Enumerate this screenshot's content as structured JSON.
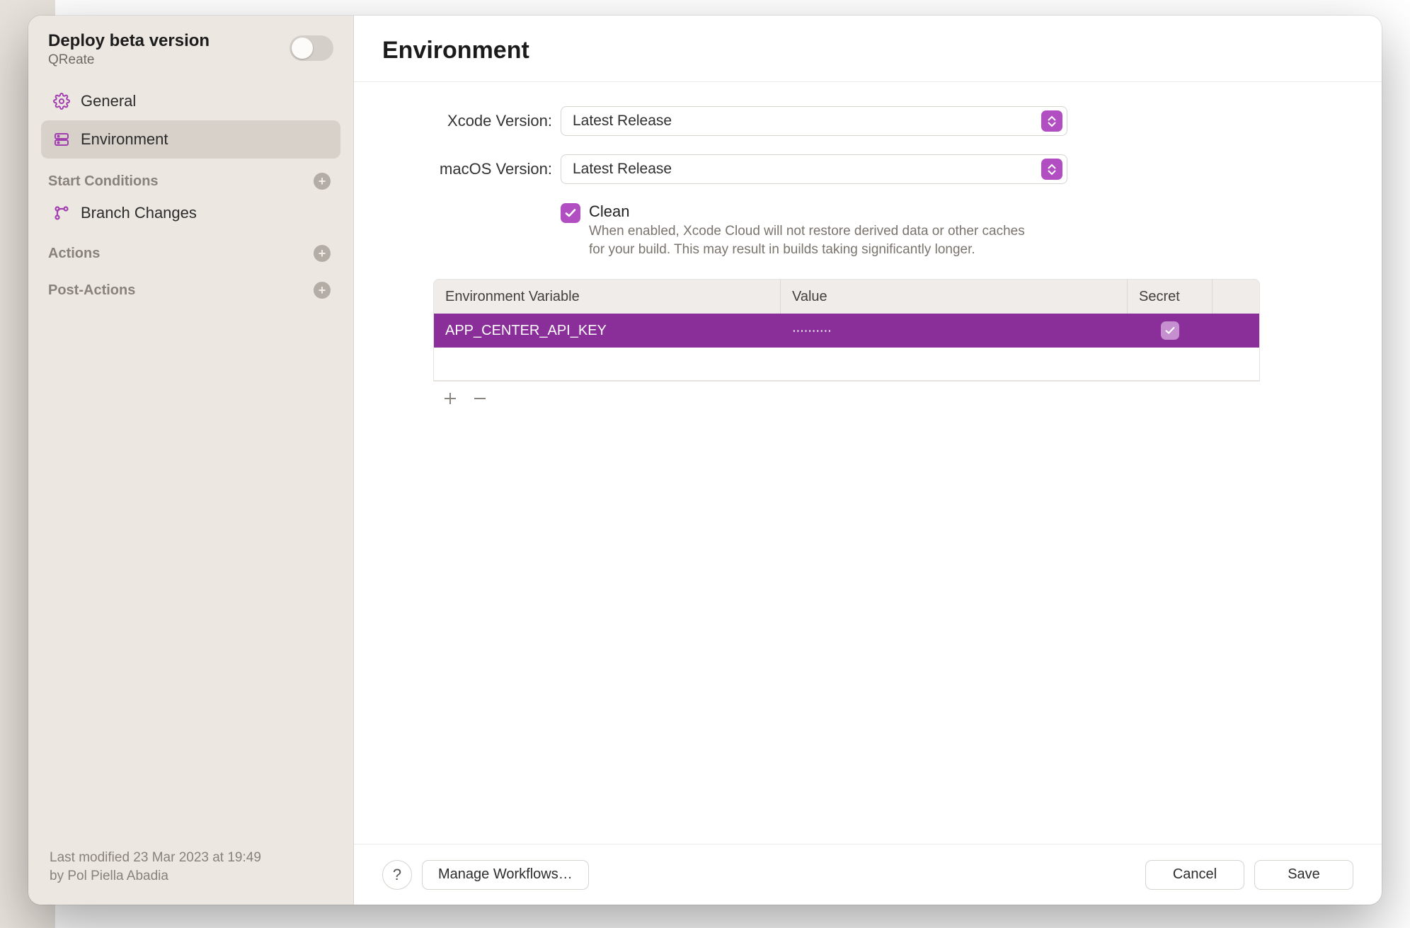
{
  "sidebar": {
    "title": "Deploy beta version",
    "subtitle": "QReate",
    "toggle_on": false,
    "nav": {
      "general": "General",
      "environment": "Environment"
    },
    "sections": {
      "start_conditions": "Start Conditions",
      "actions": "Actions",
      "post_actions": "Post-Actions"
    },
    "start_items": {
      "branch_changes": "Branch Changes"
    },
    "footer_line1": "Last modified 23 Mar 2023 at 19:49",
    "footer_line2": "by Pol Piella Abadia"
  },
  "main": {
    "heading": "Environment",
    "xcode_label": "Xcode Version:",
    "xcode_value": "Latest Release",
    "macos_label": "macOS Version:",
    "macos_value": "Latest Release",
    "clean_label": "Clean",
    "clean_desc": "When enabled, Xcode Cloud will not restore derived data or other caches for your build. This may result in builds taking significantly longer.",
    "table": {
      "col_variable": "Environment Variable",
      "col_value": "Value",
      "col_secret": "Secret",
      "rows": [
        {
          "name": "APP_CENTER_API_KEY",
          "value": "∙∙∙∙∙∙∙∙∙∙",
          "secret": true
        }
      ]
    }
  },
  "footer": {
    "help": "?",
    "manage": "Manage Workflows…",
    "cancel": "Cancel",
    "save": "Save"
  },
  "colors": {
    "accent": "#b14fc2",
    "row_selected": "#8a2f99"
  }
}
